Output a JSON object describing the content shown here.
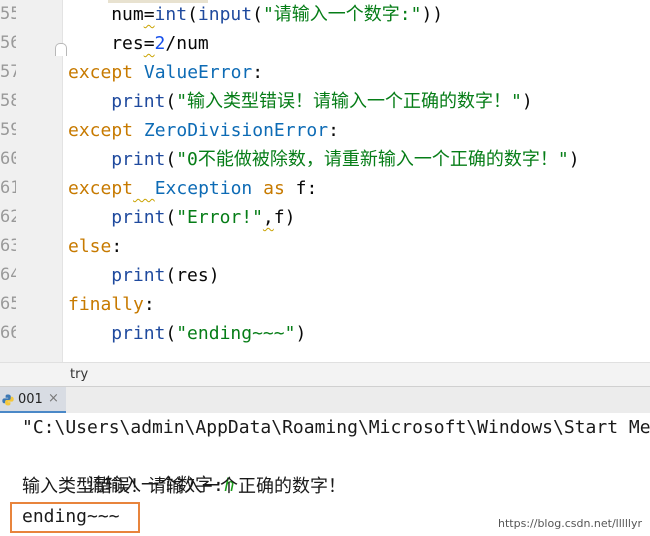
{
  "editor": {
    "lines": [
      {
        "num": "55",
        "indent": 2,
        "tokens": [
          {
            "t": "num",
            "c": ""
          },
          {
            "t": "=",
            "c": "squig"
          },
          {
            "t": "int",
            "c": "fn"
          },
          {
            "t": "(",
            "c": ""
          },
          {
            "t": "input",
            "c": "fn"
          },
          {
            "t": "(",
            "c": ""
          },
          {
            "t": "\"请输入一个数字:\"",
            "c": "str"
          },
          {
            "t": "))",
            "c": ""
          }
        ]
      },
      {
        "num": "56",
        "indent": 2,
        "tokens": [
          {
            "t": "res",
            "c": ""
          },
          {
            "t": "=",
            "c": "squig"
          },
          {
            "t": "2",
            "c": "num"
          },
          {
            "t": "/num",
            "c": ""
          }
        ]
      },
      {
        "num": "57",
        "indent": 0,
        "tokens": [
          {
            "t": "except",
            "c": "kw2"
          },
          {
            "t": " ",
            "c": ""
          },
          {
            "t": "ValueError",
            "c": "cls"
          },
          {
            "t": ":",
            "c": ""
          }
        ]
      },
      {
        "num": "58",
        "indent": 2,
        "tokens": [
          {
            "t": "print",
            "c": "fn"
          },
          {
            "t": "(",
            "c": ""
          },
          {
            "t": "\"输入类型错误！请输入一个正确的数字！\"",
            "c": "str"
          },
          {
            "t": ")",
            "c": ""
          }
        ]
      },
      {
        "num": "59",
        "indent": 0,
        "tokens": [
          {
            "t": "except",
            "c": "kw2"
          },
          {
            "t": " ",
            "c": ""
          },
          {
            "t": "ZeroDivisionError",
            "c": "cls"
          },
          {
            "t": ":",
            "c": ""
          }
        ]
      },
      {
        "num": "60",
        "indent": 2,
        "tokens": [
          {
            "t": "print",
            "c": "fn"
          },
          {
            "t": "(",
            "c": ""
          },
          {
            "t": "\"0不能做被除数，请重新输入一个正确的数字！\"",
            "c": "str"
          },
          {
            "t": ")",
            "c": ""
          }
        ]
      },
      {
        "num": "61",
        "indent": 0,
        "tokens": [
          {
            "t": "except",
            "c": "kw2"
          },
          {
            "t": "  ",
            "c": "squig"
          },
          {
            "t": "Exception",
            "c": "cls"
          },
          {
            "t": " ",
            "c": ""
          },
          {
            "t": "as",
            "c": "kw2"
          },
          {
            "t": " f:",
            "c": ""
          }
        ]
      },
      {
        "num": "62",
        "indent": 2,
        "tokens": [
          {
            "t": "print",
            "c": "fn"
          },
          {
            "t": "(",
            "c": ""
          },
          {
            "t": "\"Error!\"",
            "c": "str"
          },
          {
            "t": ",",
            "c": "squig"
          },
          {
            "t": "f)",
            "c": ""
          }
        ]
      },
      {
        "num": "63",
        "indent": 0,
        "tokens": [
          {
            "t": "else",
            "c": "kw2"
          },
          {
            "t": ":",
            "c": ""
          }
        ]
      },
      {
        "num": "64",
        "indent": 2,
        "tokens": [
          {
            "t": "print",
            "c": "fn"
          },
          {
            "t": "(res)",
            "c": ""
          }
        ]
      },
      {
        "num": "65",
        "indent": 0,
        "tokens": [
          {
            "t": "finally",
            "c": "kw2"
          },
          {
            "t": ":",
            "c": ""
          }
        ]
      },
      {
        "num": "66",
        "indent": 2,
        "tokens": [
          {
            "t": "print",
            "c": "fn"
          },
          {
            "t": "(",
            "c": ""
          },
          {
            "t": "\"ending~~~\"",
            "c": "str"
          },
          {
            "t": ")",
            "c": ""
          }
        ]
      }
    ]
  },
  "breadcrumb": {
    "label": "try"
  },
  "run_panel": {
    "tab_label": "001",
    "close_glyph": "×",
    "console": {
      "command": "\"C:\\Users\\admin\\AppData\\Roaming\\Microsoft\\Windows\\Start Men",
      "prompt": "请输入一个数字:",
      "user_input": "h",
      "error_message": "输入类型错误！请输入一个正确的数字！",
      "final_output": "ending~~~"
    }
  },
  "watermark": "https://blog.csdn.net/lllllyr",
  "colors": {
    "keyword": "#c77a00",
    "class_name": "#0d6bb5",
    "string": "#067d17",
    "highlight_box": "#e8843c"
  }
}
